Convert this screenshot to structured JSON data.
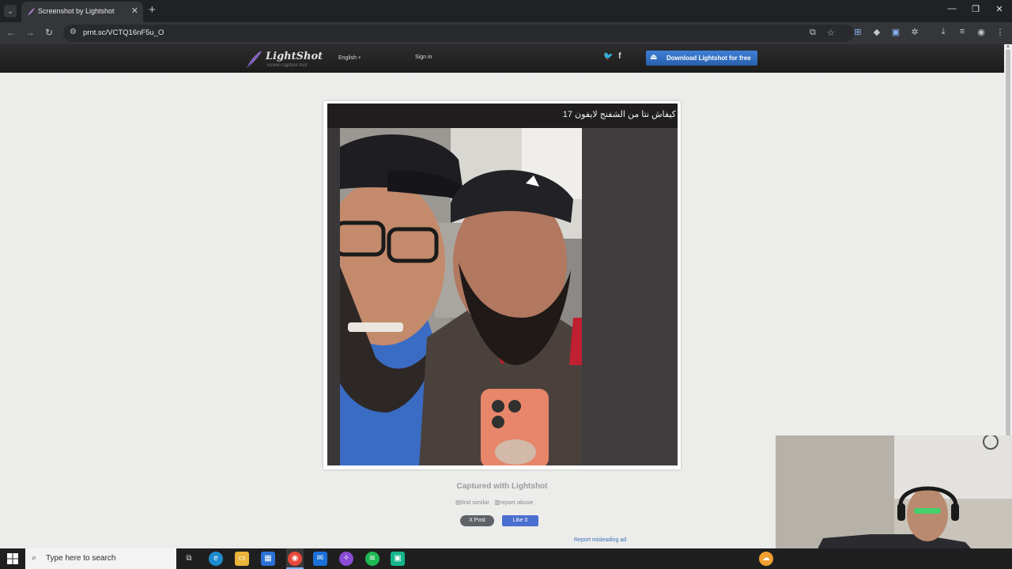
{
  "browser": {
    "tab_title": "Screenshot by Lightshot",
    "tab_close": "✕",
    "new_tab": "+",
    "url": "prnt.sc/VCTQ16nF5u_O",
    "window_controls": {
      "minimize": "—",
      "restore": "❐",
      "close": "✕"
    }
  },
  "lightshot": {
    "logo_title": "LightShot",
    "logo_subtitle": "screen capture tool",
    "language": "English",
    "sign_in": "Sign in",
    "twitter_glyph": "🐦",
    "facebook_glyph": "f",
    "download_label": "Download Lightshot for free",
    "screenshot_caption": "كيفاش نتا من الشفنج لايفون 17",
    "captured_with": "Captured with Lightshot",
    "find_similar": "find similar",
    "report_abuse": "report abuse",
    "x_post": "X Post",
    "fb_like": "Like 0",
    "report_ad": "Report misleading ad"
  },
  "taskbar": {
    "search_placeholder": "Type here to search"
  },
  "colors": {
    "download_button": "#2f6bc0",
    "header": "#1c1c1c",
    "page_bg": "#ececeb",
    "report_link": "#3b6fb5"
  }
}
